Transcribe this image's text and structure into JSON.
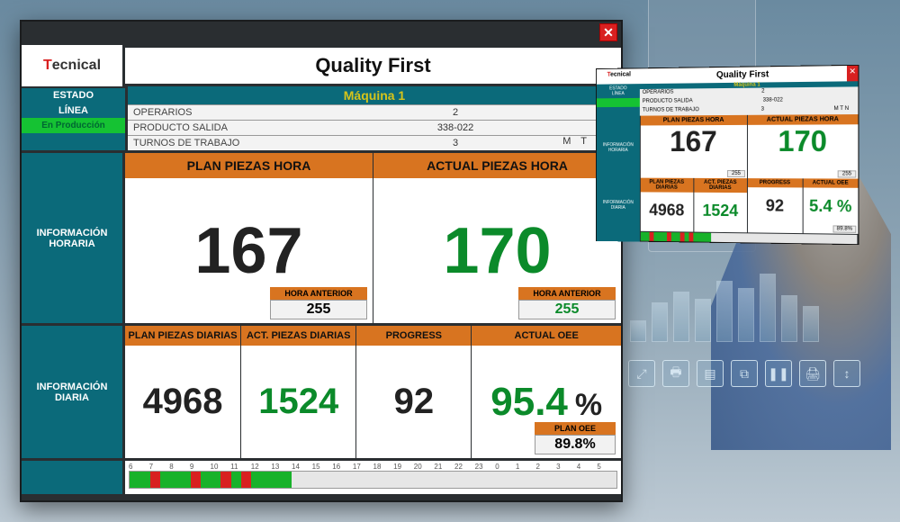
{
  "brand": {
    "prefix": "T",
    "name": "ecnical"
  },
  "title": "Quality First",
  "machine_label": "Máquina 1",
  "estado": {
    "head1": "ESTADO",
    "head2": "LÍNEA",
    "value": "En Producción"
  },
  "info": {
    "rows": [
      {
        "label": "OPERARIOS",
        "value": "2"
      },
      {
        "label": "PRODUCTO SALIDA",
        "value": "338-022"
      },
      {
        "label": "TURNOS DE TRABAJO",
        "value": "3",
        "shifts": "M T N"
      }
    ]
  },
  "hourly": {
    "side": "INFORMACIÓN\nHORARIA",
    "plan": {
      "head": "PLAN PIEZAS HORA",
      "value": "167",
      "prev_label": "HORA ANTERIOR",
      "prev_value": "255"
    },
    "actual": {
      "head": "ACTUAL PIEZAS HORA",
      "value": "170",
      "prev_label": "HORA ANTERIOR",
      "prev_value": "255"
    }
  },
  "daily": {
    "side": "INFORMACIÓN\nDIARIA",
    "plan": {
      "head": "PLAN PIEZAS DIARIAS",
      "value": "4968"
    },
    "actual": {
      "head": "ACT. PIEZAS DIARIAS",
      "value": "1524"
    },
    "progress": {
      "head": "PROGRESS",
      "value": "92"
    },
    "oee": {
      "head": "ACTUAL OEE",
      "value": "95.4",
      "pct": "%",
      "plan_label": "PLAN OEE",
      "plan_value": "89.8%"
    }
  },
  "timeline": {
    "hours": [
      "6",
      "7",
      "8",
      "9",
      "10",
      "11",
      "12",
      "13",
      "14",
      "15",
      "16",
      "17",
      "18",
      "19",
      "20",
      "21",
      "22",
      "23",
      "0",
      "1",
      "2",
      "3",
      "4",
      "5"
    ],
    "segments": [
      "g",
      "g",
      "r",
      "g",
      "g",
      "g",
      "r",
      "g",
      "g",
      "r",
      "g",
      "r",
      "g",
      "g",
      "g",
      "g",
      "e",
      "e",
      "e",
      "e",
      "e",
      "e",
      "e",
      "e",
      "e",
      "e",
      "e",
      "e",
      "e",
      "e",
      "e",
      "e",
      "e",
      "e",
      "e",
      "e",
      "e",
      "e",
      "e",
      "e",
      "e",
      "e",
      "e",
      "e",
      "e",
      "e",
      "e",
      "e"
    ]
  },
  "mini": {
    "oee_partial": "5.4 %",
    "progress_partial": "92",
    "plan_oee": "89.8%"
  },
  "colors": {
    "accent": "#d87420",
    "teal": "#0b6a7a",
    "green": "#0b8a2a",
    "red": "#d82020"
  }
}
